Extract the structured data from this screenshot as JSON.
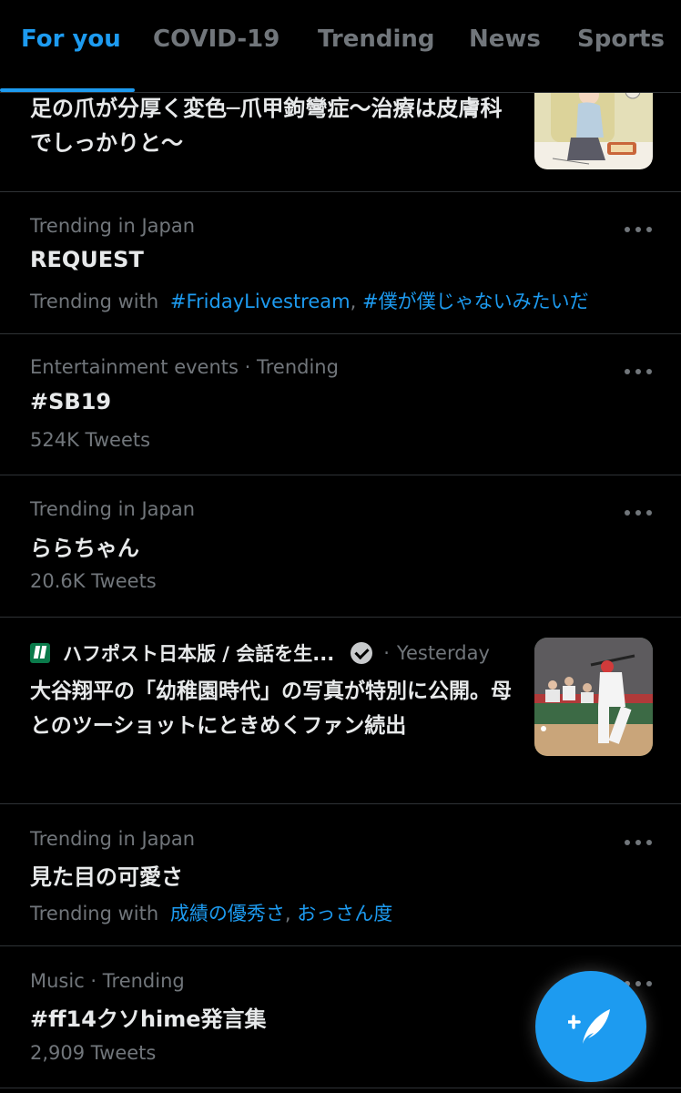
{
  "tabs": [
    {
      "label": "For you",
      "active": true
    },
    {
      "label": "COVID-19",
      "active": false
    },
    {
      "label": "Trending",
      "active": false
    },
    {
      "label": "News",
      "active": false
    },
    {
      "label": "Sports",
      "active": false
    }
  ],
  "feed": {
    "news1": {
      "title": "足の爪が分厚く変色─爪甲鉤彎症〜治療は皮膚科でしっかりと〜",
      "thumbnail": "illustration-of-person-cutting-toenails"
    },
    "trend1": {
      "context": "Trending in Japan",
      "title": "REQUEST",
      "sub_prefix": "Trending with",
      "sub_link1": "#FridayLivestream",
      "sub_separator": ",",
      "sub_link2": "#僕が僕じゃないみたいだ"
    },
    "trend2": {
      "context": "Entertainment events · Trending",
      "title": "#SB19",
      "sub": "524K Tweets"
    },
    "trend3": {
      "context": "Trending in Japan",
      "title": "ららちゃん",
      "sub": "20.6K Tweets"
    },
    "news2": {
      "source": "ハフポスト日本版 / 会話を生...",
      "dot": "·",
      "time": "Yesterday",
      "title": "大谷翔平の「幼稚園時代」の写真が特別に公開。母とのツーショットにときめくファン続出",
      "thumbnail": "baseball-batter-photo"
    },
    "trend4": {
      "context": "Trending in Japan",
      "title": "見た目の可愛さ",
      "sub_prefix": "Trending with",
      "sub_link1": "成績の優秀さ",
      "sub_separator": ",",
      "sub_link2": "おっさん度"
    },
    "trend5": {
      "context": "Music · Trending",
      "title": "#ff14クソhime発言集",
      "sub": "2,909 Tweets"
    }
  },
  "fab": {
    "icon": "compose-tweet-icon"
  },
  "colors": {
    "background": "#000000",
    "accent": "#1d9bf0",
    "text_primary": "#e7e9ea",
    "text_secondary": "#71767b",
    "divider": "#2f3336"
  }
}
